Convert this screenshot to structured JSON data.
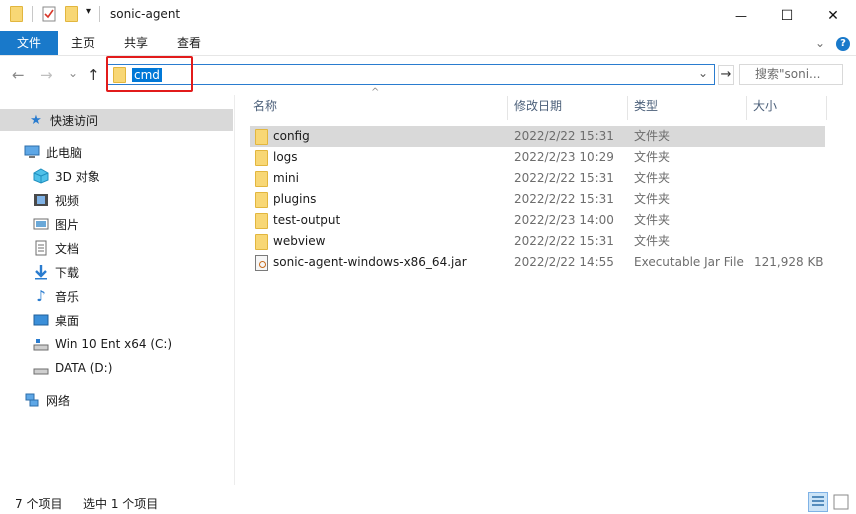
{
  "window": {
    "title": "sonic-agent",
    "minimize_glyph": "—",
    "maximize_glyph": "☐",
    "close_glyph": "✕",
    "quick_access_dropdown": "▾"
  },
  "ribbon": {
    "tabs": [
      "文件",
      "主页",
      "共享",
      "查看"
    ],
    "expand_glyph": "⌄",
    "help_glyph": "?"
  },
  "address": {
    "back": "←",
    "forward": "→",
    "recent": "⌄",
    "up": "↑",
    "path": "cmd",
    "dropdown": "⌄",
    "go": "→",
    "search_placeholder": "搜索\"soni..."
  },
  "sidebar": {
    "items": [
      {
        "label": "快速访问",
        "icon": "star-icon"
      },
      {
        "label": "此电脑",
        "icon": "computer-icon"
      },
      {
        "label": "3D 对象",
        "icon": "cube-icon"
      },
      {
        "label": "视频",
        "icon": "film-icon"
      },
      {
        "label": "图片",
        "icon": "picture-icon"
      },
      {
        "label": "文档",
        "icon": "document-icon"
      },
      {
        "label": "下载",
        "icon": "download-icon"
      },
      {
        "label": "音乐",
        "icon": "music-icon"
      },
      {
        "label": "桌面",
        "icon": "desktop-icon"
      },
      {
        "label": "Win 10 Ent x64 (C:)",
        "icon": "drive-icon"
      },
      {
        "label": "DATA (D:)",
        "icon": "drive-icon"
      },
      {
        "label": "网络",
        "icon": "network-icon"
      }
    ]
  },
  "columns": {
    "name": "名称",
    "date": "修改日期",
    "type": "类型",
    "size": "大小",
    "sort_glyph": "^"
  },
  "files": [
    {
      "name": "config",
      "date": "2022/2/22 15:31",
      "type": "文件夹",
      "size": ""
    },
    {
      "name": "logs",
      "date": "2022/2/23 10:29",
      "type": "文件夹",
      "size": ""
    },
    {
      "name": "mini",
      "date": "2022/2/22 15:31",
      "type": "文件夹",
      "size": ""
    },
    {
      "name": "plugins",
      "date": "2022/2/22 15:31",
      "type": "文件夹",
      "size": ""
    },
    {
      "name": "test-output",
      "date": "2022/2/23 14:00",
      "type": "文件夹",
      "size": ""
    },
    {
      "name": "webview",
      "date": "2022/2/22 15:31",
      "type": "文件夹",
      "size": ""
    },
    {
      "name": "sonic-agent-windows-x86_64.jar",
      "date": "2022/2/22 14:55",
      "type": "Executable Jar File",
      "size": "121,928 KB"
    }
  ],
  "status": {
    "count": "7 个项目",
    "selected": "选中 1 个项目"
  },
  "colors": {
    "accent": "#1979ca",
    "selection": "#d9d9d9",
    "highlight": "#e21b1b",
    "folder": "#f3c84d"
  }
}
